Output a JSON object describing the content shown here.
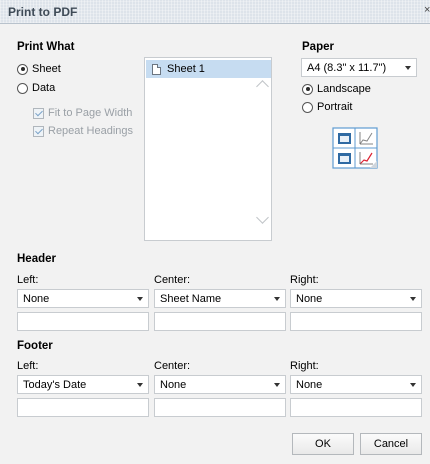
{
  "window": {
    "title": "Print to PDF",
    "close_glyph": "×"
  },
  "print_what": {
    "heading": "Print What",
    "sheet_label": "Sheet",
    "data_label": "Data",
    "fit_label": "Fit to Page Width",
    "repeat_label": "Repeat Headings",
    "selected": "Sheet",
    "sheets": [
      "Sheet 1"
    ]
  },
  "paper": {
    "heading": "Paper",
    "size": "A4 (8.3\" x 11.7\")",
    "landscape_label": "Landscape",
    "portrait_label": "Portrait",
    "orientation": "Landscape"
  },
  "header": {
    "heading": "Header",
    "left_label": "Left:",
    "center_label": "Center:",
    "right_label": "Right:",
    "left_value": "None",
    "center_value": "Sheet Name",
    "right_value": "None"
  },
  "footer": {
    "heading": "Footer",
    "left_label": "Left:",
    "center_label": "Center:",
    "right_label": "Right:",
    "left_value": "Today's Date",
    "center_value": "None",
    "right_value": "None"
  },
  "buttons": {
    "ok": "OK",
    "cancel": "Cancel"
  }
}
